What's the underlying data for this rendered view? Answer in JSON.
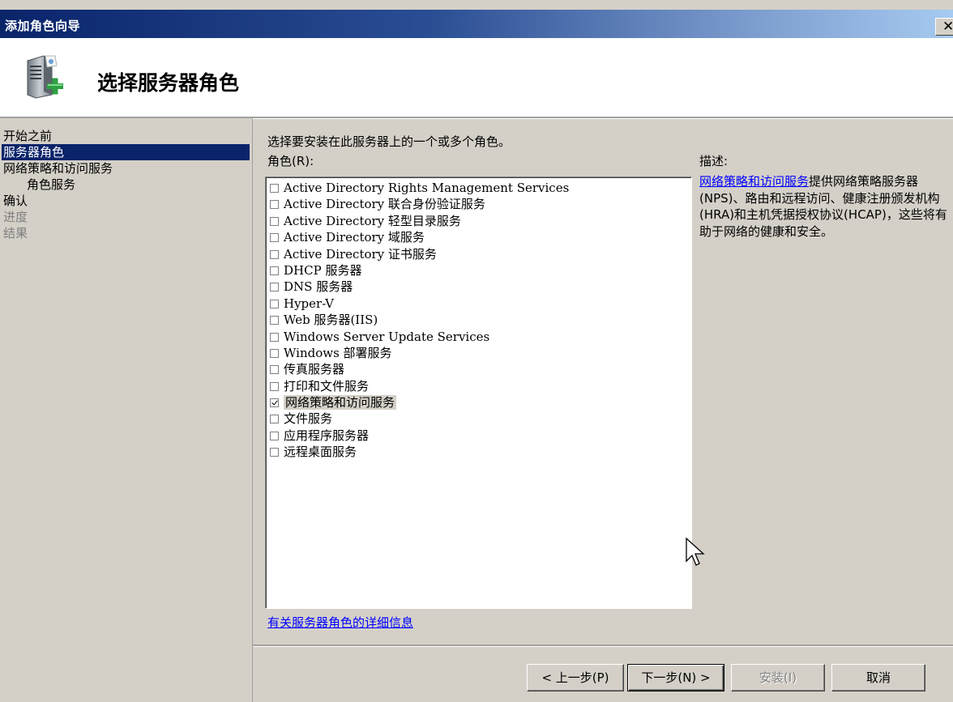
{
  "window": {
    "title": "添加角色向导",
    "close_glyph": "✕"
  },
  "header": {
    "title": "选择服务器角色",
    "icon": "server-add-icon"
  },
  "sidebar": {
    "items": [
      {
        "label": "开始之前",
        "state": "normal"
      },
      {
        "label": "服务器角色",
        "state": "selected"
      },
      {
        "label": "网络策略和访问服务",
        "state": "normal"
      },
      {
        "label": "角色服务",
        "state": "normal"
      },
      {
        "label": "确认",
        "state": "normal"
      },
      {
        "label": "进度",
        "state": "disabled"
      },
      {
        "label": "结果",
        "state": "disabled"
      }
    ]
  },
  "main": {
    "intro": "选择要安装在此服务器上的一个或多个角色。",
    "roles_label": "角色(R):",
    "description_label": "描述:",
    "roles": [
      {
        "label": "Active Directory Rights Management Services",
        "checked": false
      },
      {
        "label": "Active Directory 联合身份验证服务",
        "checked": false
      },
      {
        "label": "Active Directory 轻型目录服务",
        "checked": false
      },
      {
        "label": "Active Directory 域服务",
        "checked": false
      },
      {
        "label": "Active Directory 证书服务",
        "checked": false
      },
      {
        "label": "DHCP 服务器",
        "checked": false
      },
      {
        "label": "DNS 服务器",
        "checked": false
      },
      {
        "label": "Hyper-V",
        "checked": false
      },
      {
        "label": "Web 服务器(IIS)",
        "checked": false
      },
      {
        "label": "Windows Server Update Services",
        "checked": false
      },
      {
        "label": "Windows 部署服务",
        "checked": false
      },
      {
        "label": "传真服务器",
        "checked": false
      },
      {
        "label": "打印和文件服务",
        "checked": false
      },
      {
        "label": "网络策略和访问服务",
        "checked": true
      },
      {
        "label": "文件服务",
        "checked": false
      },
      {
        "label": "应用程序服务器",
        "checked": false
      },
      {
        "label": "远程桌面服务",
        "checked": false
      }
    ],
    "description": {
      "link": "网络策略和访问服务",
      "text": "提供网络策略服务器(NPS)、路由和远程访问、健康注册颁发机构(HRA)和主机凭据授权协议(HCAP)，这些将有助于网络的健康和安全。"
    },
    "more_info_link": "有关服务器角色的详细信息"
  },
  "buttons": {
    "back": "< 上一步(P)",
    "next": "下一步(N) >",
    "install": "安装(I)",
    "cancel": "取消"
  },
  "colors": {
    "selection": "#0a246a",
    "link": "#0000ff",
    "dialog_bg": "#d4d0c8"
  }
}
